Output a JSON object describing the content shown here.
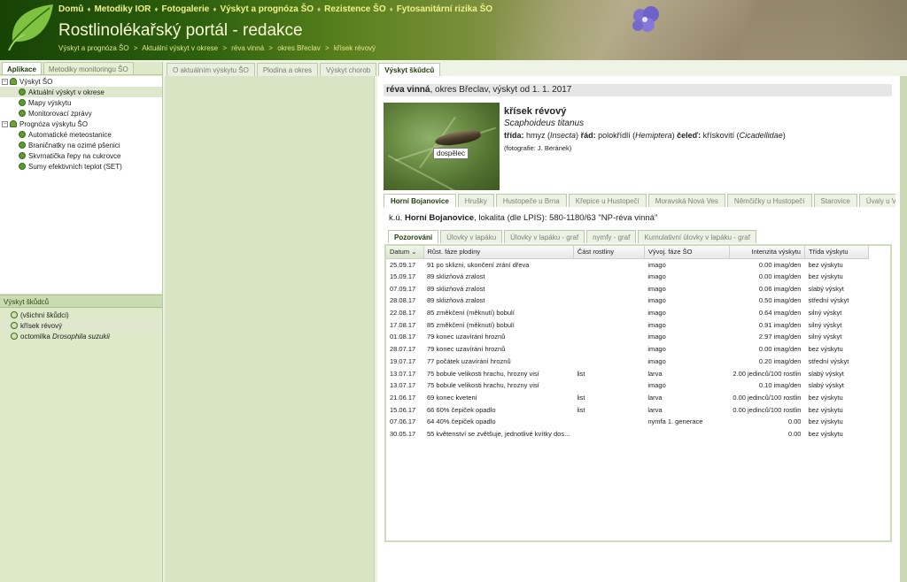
{
  "header": {
    "nav": [
      "Domů",
      "Metodiky IOR",
      "Fotogalerie",
      "Výskyt a prognóza ŠO",
      "Rezistence ŠO",
      "Fytosanitární rizika ŠO"
    ],
    "nav_sep": "♦",
    "title": "Rostlinolékařský portál - redakce",
    "breadcrumb": [
      "Výskyt a prognóza ŠO",
      "Aktuální výskyt v okrese",
      "réva vinná",
      "okres Břeclav",
      "křísek révový"
    ],
    "breadcrumb_sep": ">"
  },
  "left": {
    "tabs": [
      "Aplikace",
      "Metodiky monitoringu ŠO"
    ],
    "tree": [
      {
        "label": "Výskyt ŠO",
        "expander": "−"
      },
      {
        "label": "Aktuální výskyt v okrese"
      },
      {
        "label": "Mapy výskytu"
      },
      {
        "label": "Monitorovací zprávy"
      },
      {
        "label": "Prognóza výskytu ŠO",
        "expander": "−"
      },
      {
        "label": "Automatické meteostanice"
      },
      {
        "label": "Braničnatky na ozimé pšenici"
      },
      {
        "label": "Skvrnatička řepy na cukrovce"
      },
      {
        "label": "Sumy efektivních teplot (SET)"
      }
    ],
    "pests_header": "Výskyt škůdců",
    "pests": [
      "(všichni škůdci)",
      "křísek révový",
      "octomilka"
    ],
    "pest_italic": "Drosophila suzukii"
  },
  "main_tabs": [
    "O aktuálním výskytu ŠO",
    "Plodina a okres",
    "Výskyt chorob",
    "Výskyt škůdců"
  ],
  "location": {
    "crop": "réva vinná",
    "rest": ", okres Břeclav, výskyt od 1. 1. 2017"
  },
  "pest": {
    "name": "křísek révový",
    "latin": "Scaphoideus titanus",
    "taxonomy_trida_label": "třída:",
    "taxonomy_trida": "hmyz (",
    "taxonomy_trida_lat": "Insecta",
    "taxonomy_rad_label": "řád:",
    "taxonomy_rad": "polokřídlí (",
    "taxonomy_rad_lat": "Hemiptera",
    "taxonomy_celed_label": "čeleď:",
    "taxonomy_celed": "křískovití (",
    "taxonomy_celed_lat": "Cicadellidae",
    "close_paren": ")",
    "photo_label": "dospělec",
    "photo_credit": "(fotografie: J. Beránek)"
  },
  "locality_tabs": [
    "Horní Bojanovice",
    "Hrušky",
    "Hustopeče u Brna",
    "Křepice u Hustopečí",
    "Moravská Nová Ves",
    "Němčičky u Hustopečí",
    "Starovice",
    "Úvaly u Valtic",
    "V"
  ],
  "locality_info": {
    "prefix": "k.ú. ",
    "name": "Horní Bojanovice",
    "rest": ", lokalita (dle LPIS): 580-1180/63 \"NP-réva vinná\""
  },
  "sub_tabs": [
    "Pozorování",
    "Úlovky v lapáku",
    "Úlovky v lapáku - graf",
    "nymfy - graf",
    "Kumulativní úlovky v lapáku - graf"
  ],
  "table": {
    "columns": [
      "Datum",
      "Růst. fáze plodiny",
      "Část rostliny",
      "Vývoj. fáze ŠO",
      "Intenzita výskytu",
      "Třída výskytu"
    ],
    "sort_marker": "⌄",
    "rows": [
      [
        "25.09.17",
        "91 po sklizni, ukončení zrání dřeva",
        "",
        "imago",
        "0.00 imag/den",
        "bez výskytu"
      ],
      [
        "15.09.17",
        "89 sklizňová zralost",
        "",
        "imago",
        "0.00 imag/den",
        "bez výskytu"
      ],
      [
        "07.09.17",
        "89 sklizňová zralost",
        "",
        "imago",
        "0.06 imag/den",
        "slabý výskyt"
      ],
      [
        "28.08.17",
        "89 sklizňová zralost",
        "",
        "imago",
        "0.50 imag/den",
        "střední výskyt"
      ],
      [
        "22.08.17",
        "85 změkčení (měknutí) bobulí",
        "",
        "imago",
        "0.64 imag/den",
        "silný výskyt"
      ],
      [
        "17.08.17",
        "85 změkčení (měknutí) bobulí",
        "",
        "imago",
        "0.91 imag/den",
        "silný výskyt"
      ],
      [
        "01.08.17",
        "79 konec uzavírání hroznů",
        "",
        "imago",
        "2.97 imag/den",
        "silný výskyt"
      ],
      [
        "28.07.17",
        "79 konec uzavírání hroznů",
        "",
        "imago",
        "0.00 imag/den",
        "bez výskytu"
      ],
      [
        "19.07.17",
        "77 počátek uzavírání hroznů",
        "",
        "imago",
        "0.20 imag/den",
        "střední výskyt"
      ],
      [
        "13.07.17",
        "75 bobule velikosti hrachu, hrozny visí",
        "list",
        "larva",
        "2.00 jedinců/100 rostlin",
        "slabý výskyt"
      ],
      [
        "13.07.17",
        "75 bobule velikosti hrachu, hrozny visí",
        "",
        "imago",
        "0.10 imag/den",
        "slabý výskyt"
      ],
      [
        "21.06.17",
        "69 konec kvetení",
        "list",
        "larva",
        "0.00 jedinců/100 rostlin",
        "bez výskytu"
      ],
      [
        "15.06.17",
        "66 60% čepiček opadlo",
        "list",
        "larva",
        "0.00 jedinců/100 rostlin",
        "bez výskytu"
      ],
      [
        "07.06.17",
        "64 40% čepiček opadlo",
        "",
        "nymfa 1. generace",
        "0.00",
        "bez výskytu"
      ],
      [
        "30.05.17",
        "55 květenství se zvětšuje, jednotlivé kvítky dos...",
        "",
        "",
        "0.00",
        "bez výskytu"
      ]
    ]
  }
}
